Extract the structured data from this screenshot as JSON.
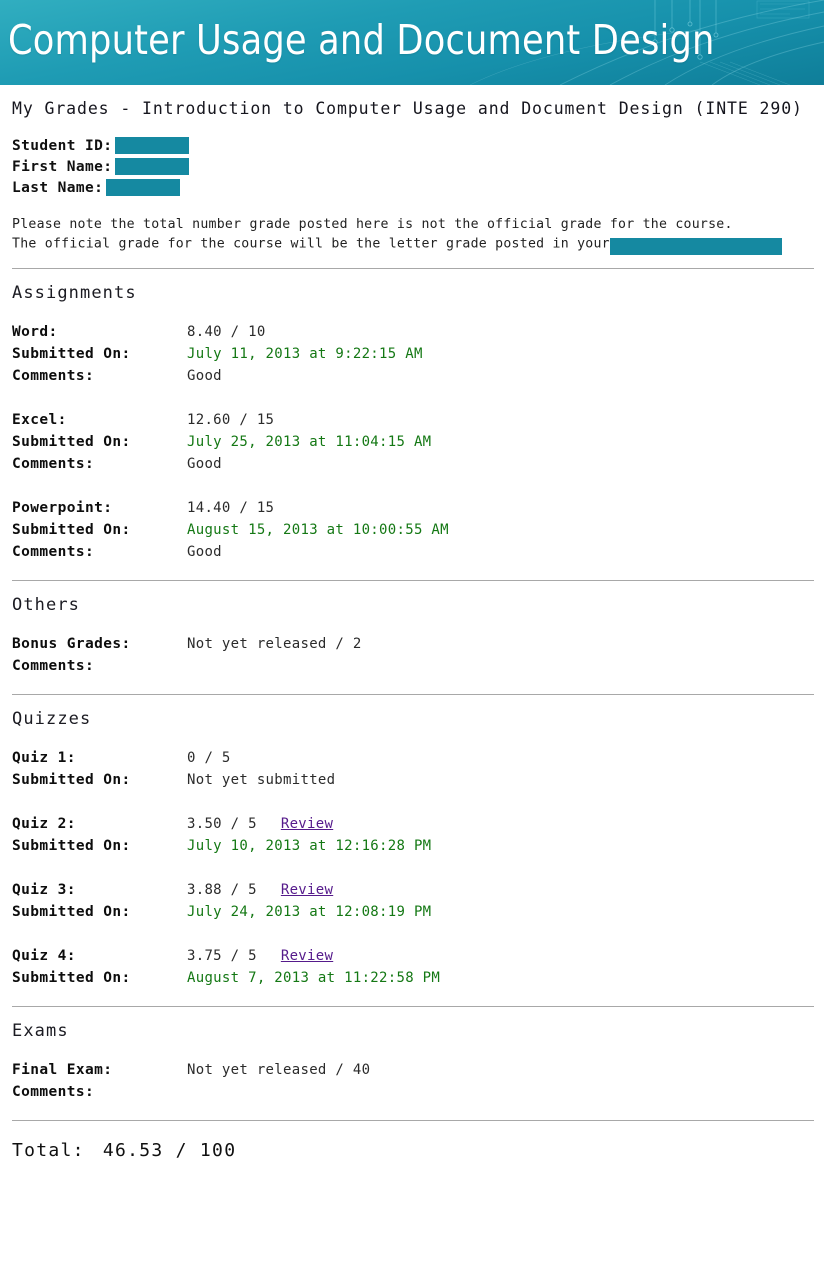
{
  "banner": {
    "title": "Computer Usage and Document Design",
    "background_color": "#1690ab",
    "text_color": "#ffffff"
  },
  "page_title": "My Grades - Introduction to Computer Usage and Document Design (INTE 290)",
  "student": {
    "rows": [
      {
        "label": "Student ID:",
        "value": "",
        "redacted": true
      },
      {
        "label": "First Name:",
        "value": "",
        "redacted": true
      },
      {
        "label": "Last Name:",
        "value": "",
        "redacted": true
      }
    ]
  },
  "note": {
    "line1": "Please note the total number grade posted here is not the official grade for the course.",
    "line2_prefix": "The official grade for the course will be the letter grade posted in your",
    "line2_redacted": true
  },
  "sections": [
    {
      "heading": "Assignments",
      "groups": [
        {
          "rows": [
            {
              "label": "Word:",
              "value": "8.40 / 10",
              "kind": "score"
            },
            {
              "label": "Submitted On:",
              "value": "July 11, 2013 at 9:22:15 AM",
              "kind": "date"
            },
            {
              "label": "Comments:",
              "value": "Good",
              "kind": "plain"
            }
          ]
        },
        {
          "rows": [
            {
              "label": "Excel:",
              "value": "12.60 / 15",
              "kind": "score"
            },
            {
              "label": "Submitted On:",
              "value": "July 25, 2013 at 11:04:15 AM",
              "kind": "date"
            },
            {
              "label": "Comments:",
              "value": "Good",
              "kind": "plain"
            }
          ]
        },
        {
          "rows": [
            {
              "label": "Powerpoint:",
              "value": "14.40 / 15",
              "kind": "score"
            },
            {
              "label": "Submitted On:",
              "value": "August 15, 2013 at 10:00:55 AM",
              "kind": "date"
            },
            {
              "label": "Comments:",
              "value": "Good",
              "kind": "plain"
            }
          ]
        }
      ]
    },
    {
      "heading": "Others",
      "groups": [
        {
          "rows": [
            {
              "label": "Bonus Grades:",
              "value": "Not yet released / 2",
              "kind": "score"
            },
            {
              "label": "Comments:",
              "value": "",
              "kind": "plain"
            }
          ]
        }
      ]
    },
    {
      "heading": "Quizzes",
      "groups": [
        {
          "rows": [
            {
              "label": "Quiz 1:",
              "value": "0 / 5",
              "kind": "score"
            },
            {
              "label": "Submitted On:",
              "value": "Not yet submitted",
              "kind": "plain"
            }
          ]
        },
        {
          "rows": [
            {
              "label": "Quiz 2:",
              "value": "3.50 / 5",
              "kind": "score",
              "link": "Review"
            },
            {
              "label": "Submitted On:",
              "value": "July 10, 2013 at 12:16:28 PM",
              "kind": "date"
            }
          ]
        },
        {
          "rows": [
            {
              "label": "Quiz 3:",
              "value": "3.88 / 5",
              "kind": "score",
              "link": "Review"
            },
            {
              "label": "Submitted On:",
              "value": "July 24, 2013 at 12:08:19 PM",
              "kind": "date"
            }
          ]
        },
        {
          "rows": [
            {
              "label": "Quiz 4:",
              "value": "3.75 / 5",
              "kind": "score",
              "link": "Review"
            },
            {
              "label": "Submitted On:",
              "value": "August 7, 2013 at 11:22:58 PM",
              "kind": "date"
            }
          ]
        }
      ]
    },
    {
      "heading": "Exams",
      "groups": [
        {
          "rows": [
            {
              "label": "Final Exam:",
              "value": "Not yet released / 40",
              "kind": "score"
            },
            {
              "label": "Comments:",
              "value": "",
              "kind": "plain"
            }
          ]
        }
      ]
    }
  ],
  "total": {
    "label": "Total:",
    "value": "46.53 / 100"
  },
  "colors": {
    "teal": "#1589a1",
    "date_green": "#147814",
    "link_purple": "#551a8b",
    "divider_gray": "#a8a8a8"
  }
}
